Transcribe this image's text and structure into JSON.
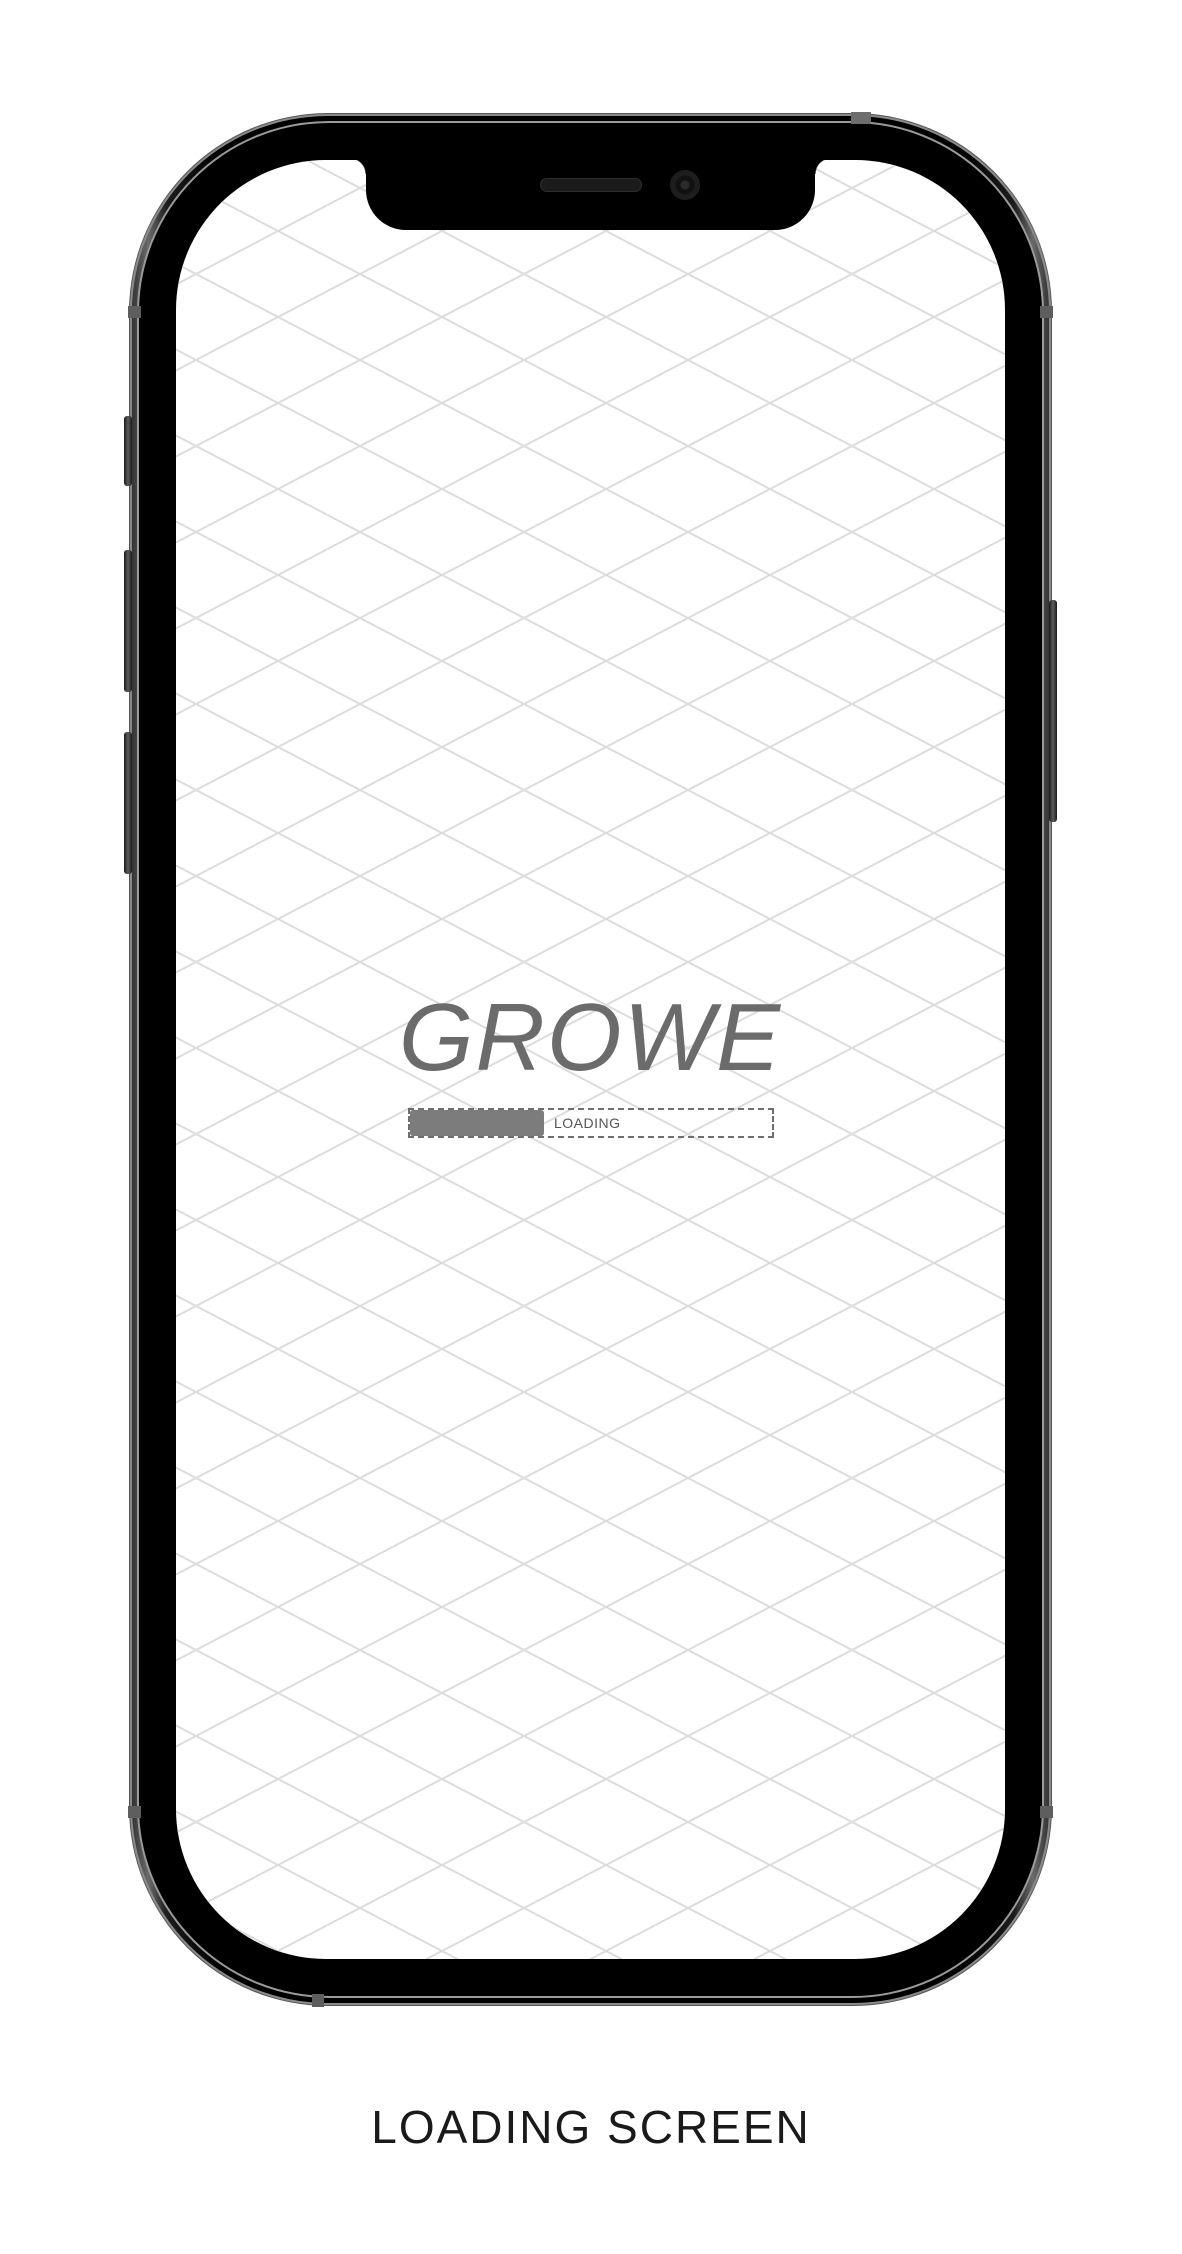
{
  "screen": {
    "brand": "GROWE",
    "progress": {
      "label": "LOADING",
      "fraction": 0.37
    },
    "colors": {
      "background": "#ffffff",
      "grid_line": "#dcdcdc",
      "brand_text": "#6b6b6b",
      "progress_fill": "#7c7c7c"
    }
  },
  "caption": "LOADING SCREEN",
  "device": {
    "frame_color": "#000000"
  }
}
